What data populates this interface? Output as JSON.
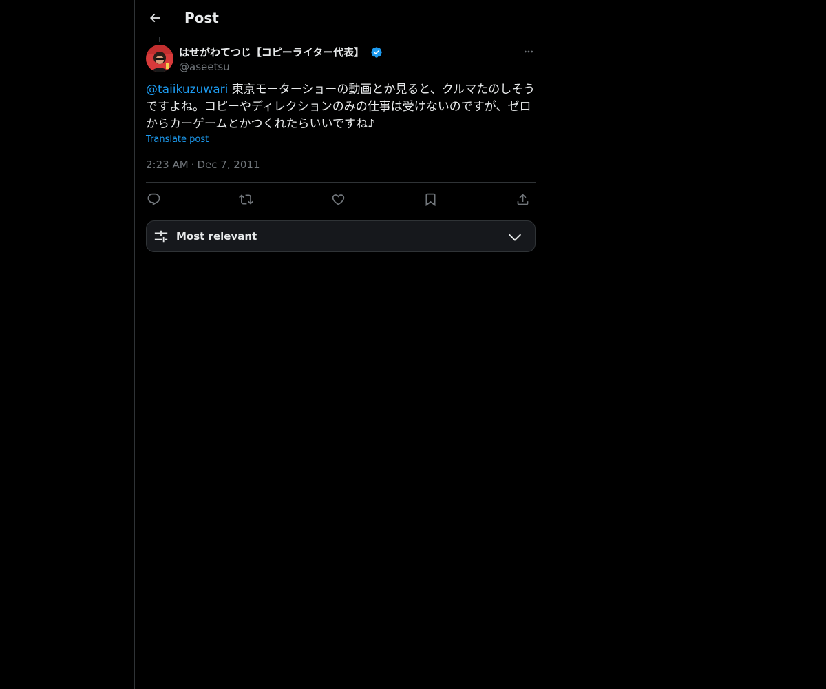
{
  "header": {
    "title": "Post"
  },
  "post": {
    "author": {
      "display_name": "はせがわてつじ【コピーライター代表】",
      "handle": "@aseetsu",
      "verified": true
    },
    "mention": "@taiikuzuwari",
    "body": " 東京モーターショーの動画とか見ると、クルマたのしそうですよね。コピーやディレクションのみの仕事は受けないのですが、ゼロからカーゲームとかつくれたらいいですね♪",
    "translate_label": "Translate post",
    "time": "2:23 AM",
    "separator": "·",
    "date": "Dec 7, 2011"
  },
  "actions": {
    "icons": [
      "reply-icon",
      "repost-icon",
      "like-icon",
      "bookmark-icon",
      "share-icon"
    ]
  },
  "replies_sort": {
    "label": "Most relevant"
  },
  "colors": {
    "background": "#000000",
    "text": "#e7e9ea",
    "secondary_text": "#71767b",
    "accent": "#1d9bf0",
    "border": "#2f3336"
  }
}
